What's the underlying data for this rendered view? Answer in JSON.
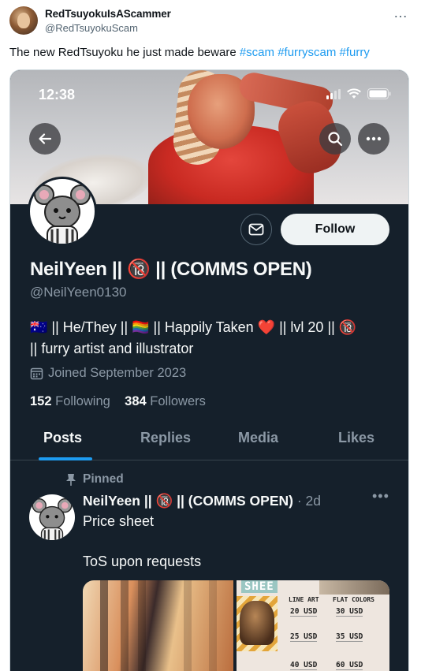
{
  "tweet": {
    "author_name": "RedTsuyokuIsAScammer",
    "author_handle": "@RedTsuyokuScam",
    "more_icon": "…",
    "text_prefix": "The new RedTsuyoku he just made beware ",
    "hashtags": [
      "#scam",
      "#furryscam",
      "#furry"
    ]
  },
  "screenshot": {
    "status_time": "12:38",
    "profile": {
      "display_name": "NeilYeen || 🔞 || (COMMS OPEN)",
      "handle": "@NeilYeen0130",
      "follow_label": "Follow",
      "bio_line1": "🇦🇺 || He/They || 🏳️‍🌈 || Happily Taken ❤️ || lvl 20 || 🔞",
      "bio_line2": "|| furry artist and illustrator",
      "joined": "Joined September 2023",
      "following_count": "152",
      "following_label": "Following",
      "followers_count": "384",
      "followers_label": "Followers"
    },
    "tabs": [
      "Posts",
      "Replies",
      "Media",
      "Likes"
    ],
    "active_tab": "Posts",
    "pinned_post": {
      "pinned_label": "Pinned",
      "name": "NeilYeen || 🔞 || (COMMS OPEN)",
      "time": "· 2d",
      "line1": "Price sheet",
      "line2": "ToS upon requests",
      "media_sheet": {
        "title": "SHEE",
        "col1": "LINE ART",
        "col2": "FLAT COLORS",
        "prices_col1": [
          "20 USD",
          "25 USD",
          "40 USD"
        ],
        "prices_col2": [
          "30 USD",
          "35 USD",
          "60 USD"
        ]
      }
    }
  }
}
